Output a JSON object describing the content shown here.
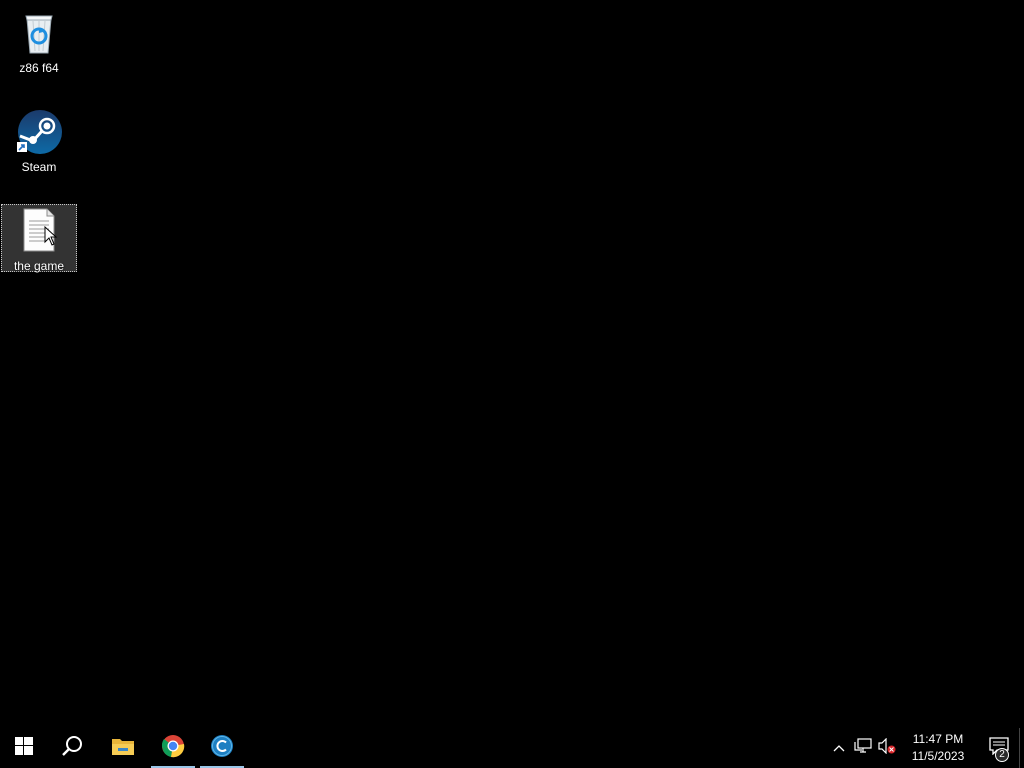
{
  "desktop": {
    "icons": [
      {
        "label": "z86 f64",
        "icon": "recycle-bin-icon"
      },
      {
        "label": "Steam",
        "icon": "steam-icon"
      },
      {
        "label": "the game",
        "icon": "text-document-icon",
        "selected": true
      }
    ]
  },
  "taskbar": {
    "pinned": [
      {
        "name": "start",
        "icon": "windows-logo-icon"
      },
      {
        "name": "search",
        "icon": "search-icon"
      },
      {
        "name": "file-explorer",
        "icon": "folder-icon"
      },
      {
        "name": "chrome",
        "icon": "chrome-icon",
        "active": true
      },
      {
        "name": "ccleaner",
        "icon": "ccleaner-icon",
        "active": true
      }
    ],
    "tray": {
      "icons": [
        "chevron-up-icon",
        "network-icon",
        "volume-muted-icon"
      ],
      "time": "11:47 PM",
      "date": "11/5/2023",
      "notification_count": "2"
    }
  },
  "colors": {
    "background": "#000000",
    "taskbar": "#000000",
    "active_indicator": "#9ac6e8"
  }
}
